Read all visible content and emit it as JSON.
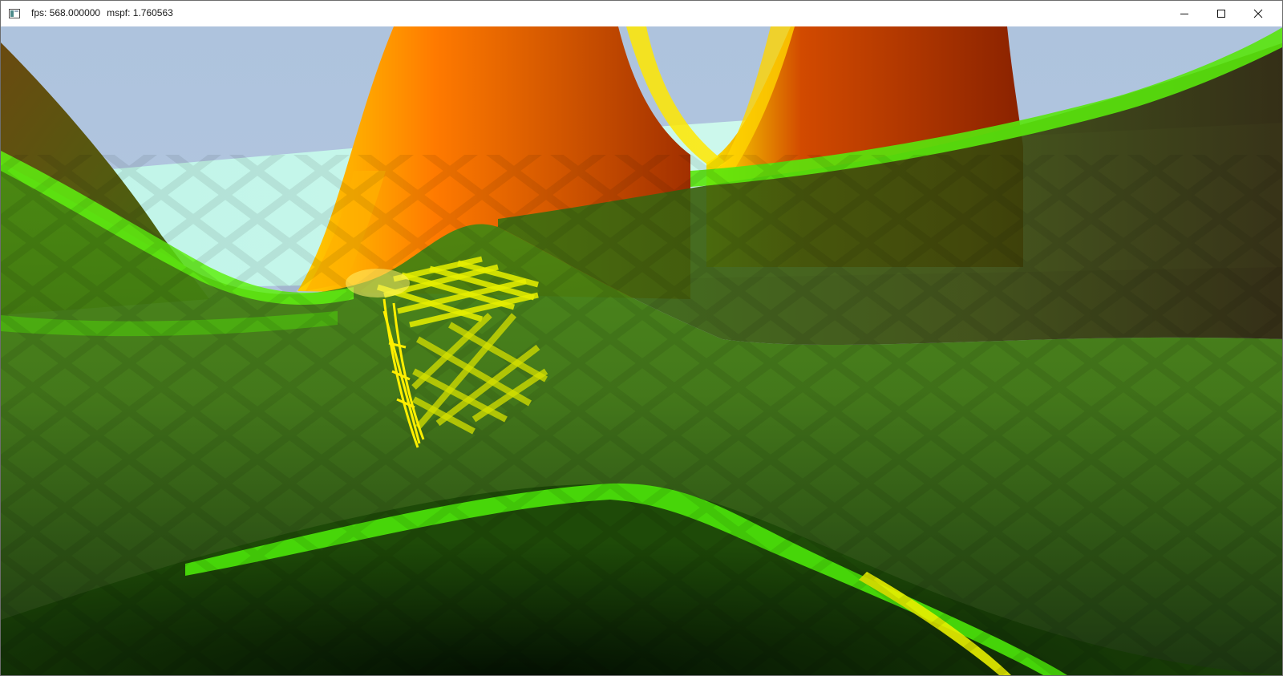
{
  "window": {
    "fps_label": "fps:",
    "fps_value": "568.000000",
    "mspf_label": "mspf:",
    "mspf_value": "1.760563",
    "app_icon": "window-app-icon",
    "controls": {
      "minimize_icon": "minimize-icon",
      "maximize_icon": "maximize-icon",
      "close_icon": "close-icon"
    }
  },
  "scene": {
    "description_icons": [
      "sky",
      "water-plane",
      "terrain-mesh",
      "orange-peaks",
      "wireframe-cube"
    ],
    "colors": {
      "sky": "#aec3dd",
      "water": "#c8f5ea",
      "terrain_bright": "#3fe60a",
      "terrain_dark": "#0d2a03",
      "peak_orange": "#ff7a00",
      "peak_dark": "#9a2c00",
      "peak_yellow": "#ffe800",
      "cube_yellow": "#e8f000"
    }
  }
}
